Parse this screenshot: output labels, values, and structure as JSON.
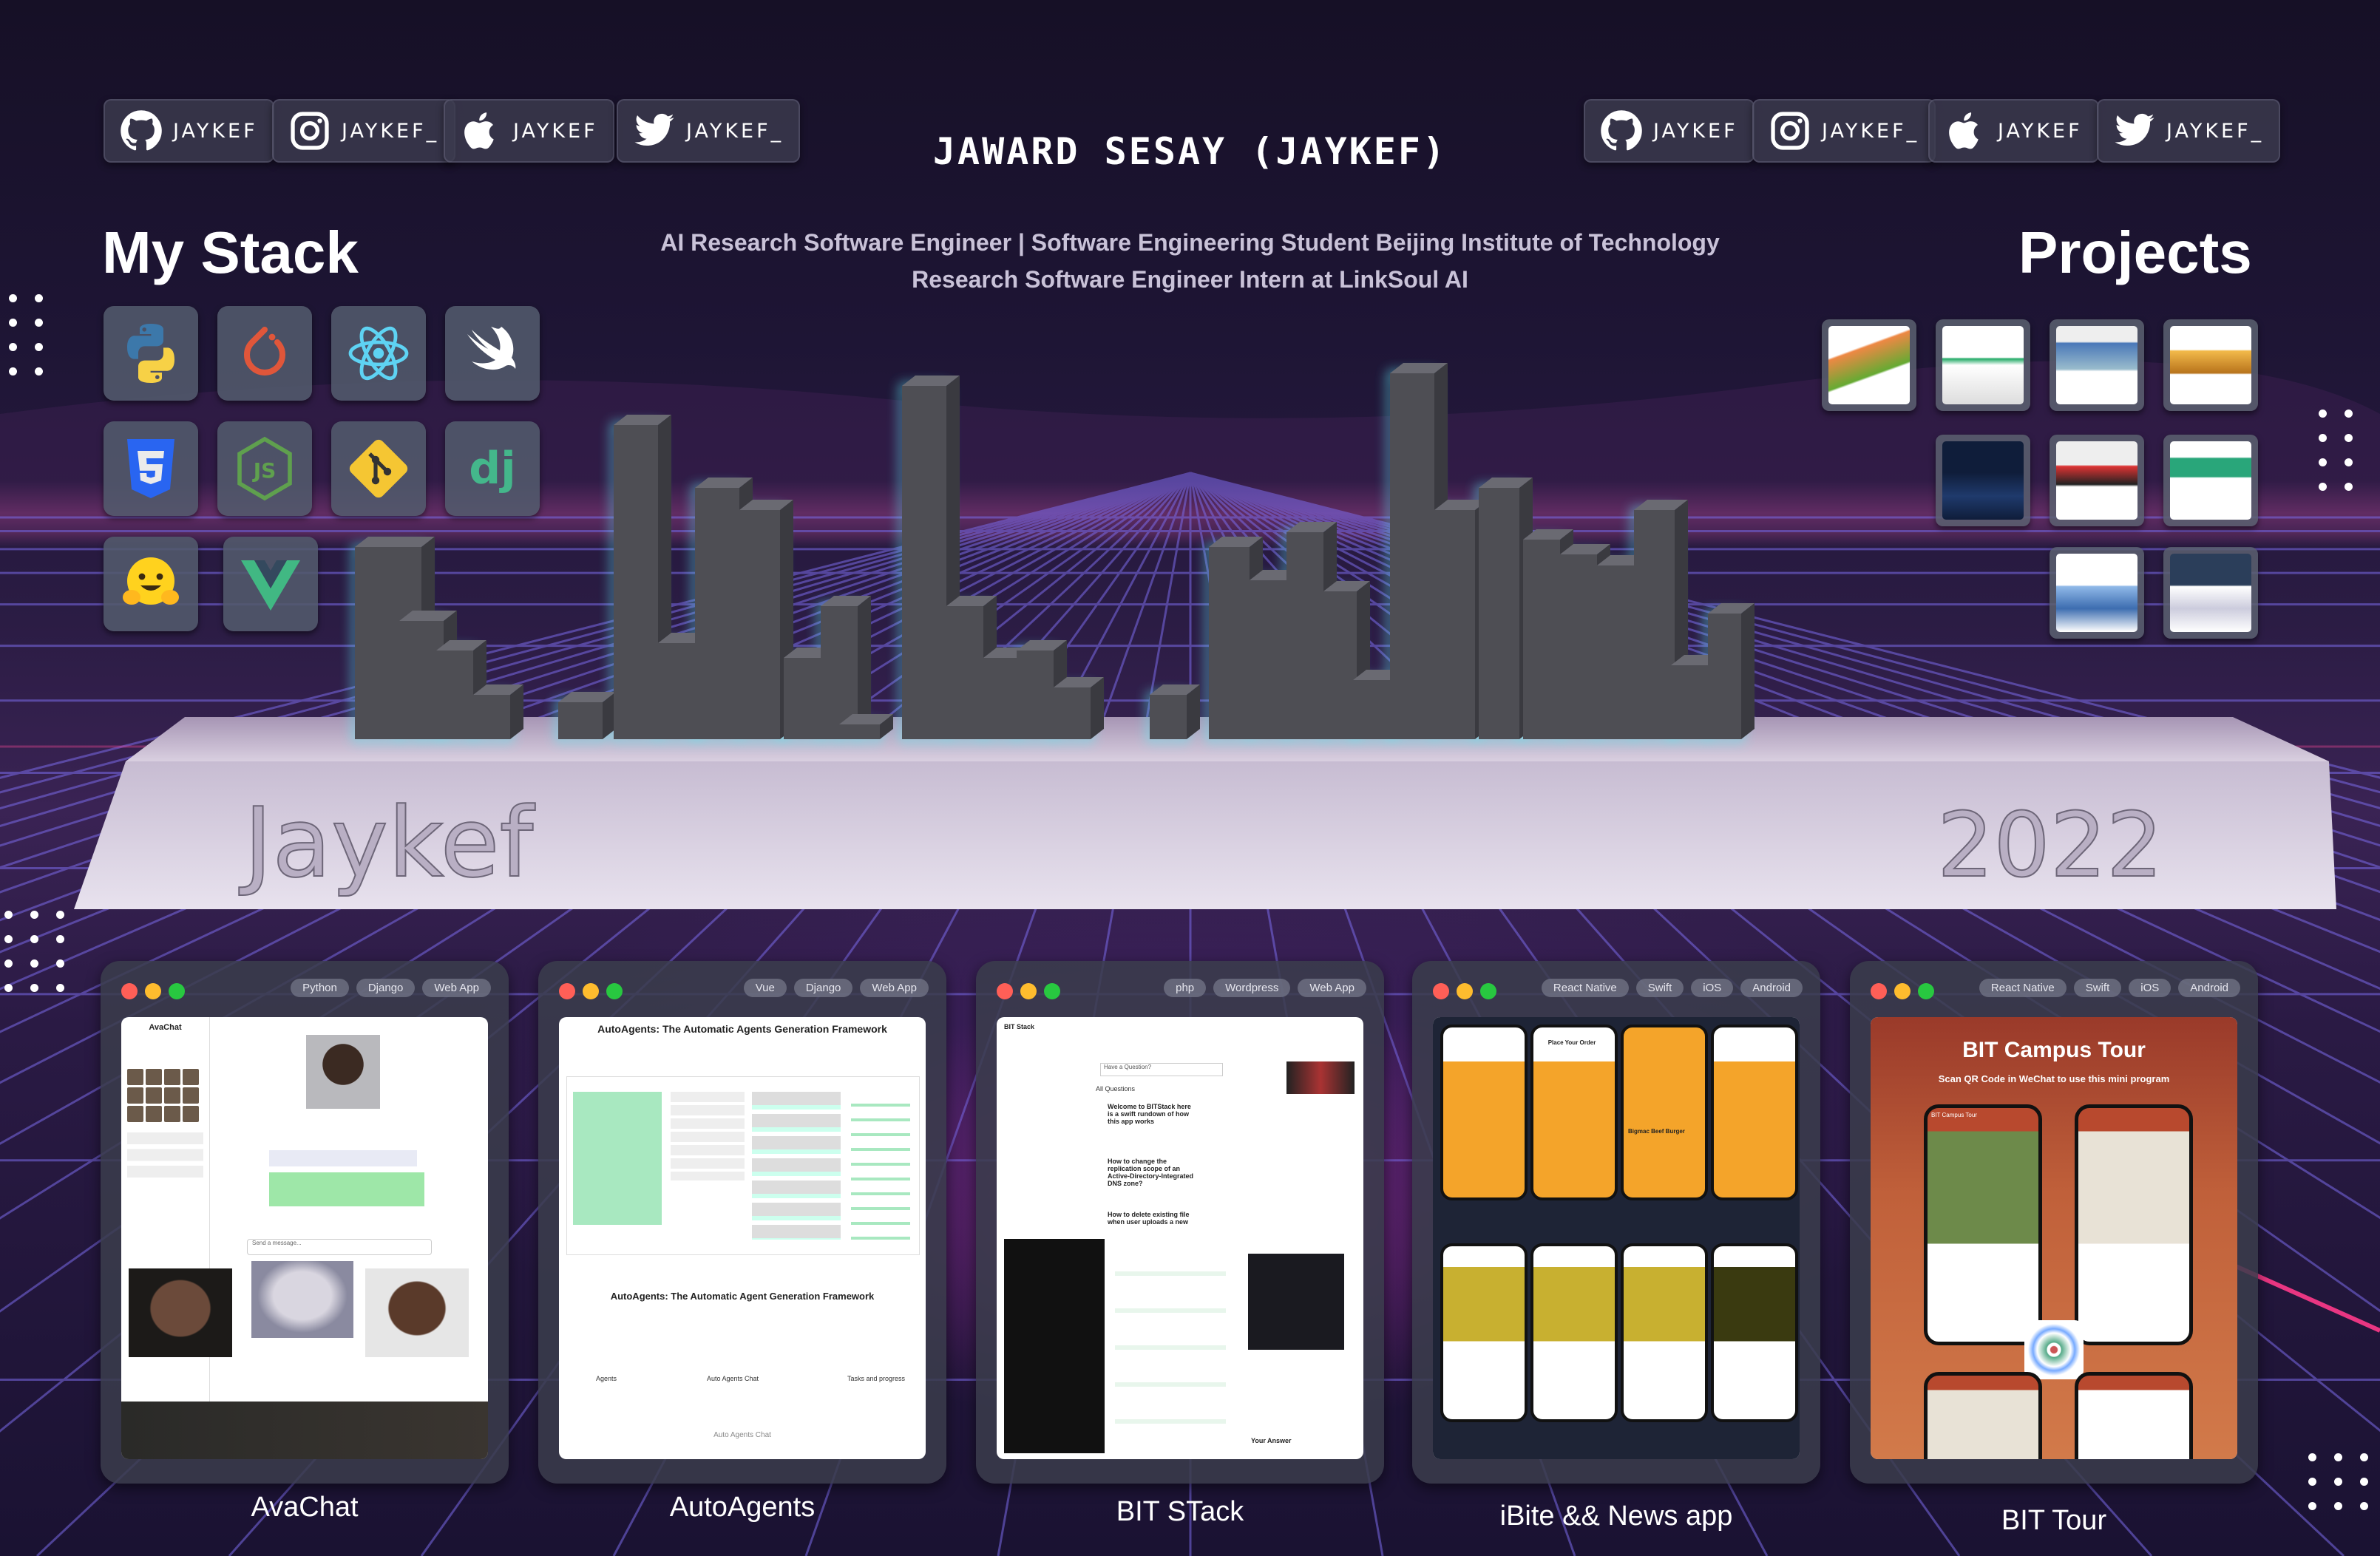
{
  "header": {
    "title": "JAWARD SESAY (JAYKEF)",
    "subtitle_line1": "AI Research Software Engineer | Software Engineering Student Beijing Institute of Technology",
    "subtitle_line2": "Research Software Engineer Intern at LinkSoul AI"
  },
  "social_left": [
    {
      "icon": "github-icon",
      "label": "JAYKEF"
    },
    {
      "icon": "instagram-icon",
      "label": "JAYKEF_"
    },
    {
      "icon": "apple-icon",
      "label": "JAYKEF"
    },
    {
      "icon": "twitter-icon",
      "label": "JAYKEF_"
    }
  ],
  "social_right": [
    {
      "icon": "github-icon",
      "label": "JAYKEF"
    },
    {
      "icon": "instagram-icon",
      "label": "JAYKEF_"
    },
    {
      "icon": "apple-icon",
      "label": "JAYKEF"
    },
    {
      "icon": "twitter-icon",
      "label": "JAYKEF_"
    }
  ],
  "stack": {
    "heading": "My Stack",
    "icons": [
      "python-icon",
      "pytorch-icon",
      "react-icon",
      "swift-icon",
      "css3-icon",
      "nodejs-icon",
      "git-icon",
      "django-icon",
      "huggingface-icon",
      "vue-icon"
    ]
  },
  "projects": {
    "heading": "Projects",
    "count": 10
  },
  "city_base": {
    "left_text": "Jaykef",
    "right_text": "2022"
  },
  "cards": [
    {
      "caption": "AvaChat",
      "tags": [
        "Python",
        "Django",
        "Web App"
      ],
      "screen": {
        "app_title": "AvaChat",
        "input_placeholder": "Send a message..."
      }
    },
    {
      "caption": "AutoAgents",
      "tags": [
        "Vue",
        "Django",
        "Web App"
      ],
      "screen": {
        "heading": "AutoAgents: The Automatic Agents Generation Framework",
        "heading2": "AutoAgents: The Automatic Agent Generation Framework",
        "col1": "Agents",
        "col2": "Auto Agents Chat",
        "col3": "Tasks and progress",
        "footer": "Auto Agents Chat"
      }
    },
    {
      "caption": "BIT STack",
      "tags": [
        "php",
        "Wordpress",
        "Web App"
      ],
      "screen": {
        "brand": "BIT Stack",
        "search": "Have a Question?",
        "list_title": "All Questions",
        "q1": "Welcome to BITStack here is a swift rundown of how this app works",
        "q2": "How to change the replication scope of an Active-Directory-Integrated DNS zone?",
        "q3": "How to delete existing file when user uploads a new",
        "answer": "Your Answer"
      }
    },
    {
      "caption": "iBite && News app",
      "tags": [
        "React Native",
        "Swift",
        "iOS",
        "Android"
      ],
      "screen": {
        "order_title": "Place Your Order",
        "burger": "Bigmac Beef Burger"
      }
    },
    {
      "caption": "BIT Tour",
      "tags": [
        "React Native",
        "Swift",
        "iOS",
        "Android"
      ],
      "screen": {
        "title": "BIT Campus Tour",
        "subtitle": "Scan QR Code in WeChat to use this mini program",
        "phone_title": "BIT Campus Tour"
      }
    }
  ],
  "colors": {
    "accent_pink": "#e0478f",
    "grid_blue": "#6a7fe8",
    "neon_cyan": "#5fe8f0",
    "building": "#4e4e54"
  }
}
